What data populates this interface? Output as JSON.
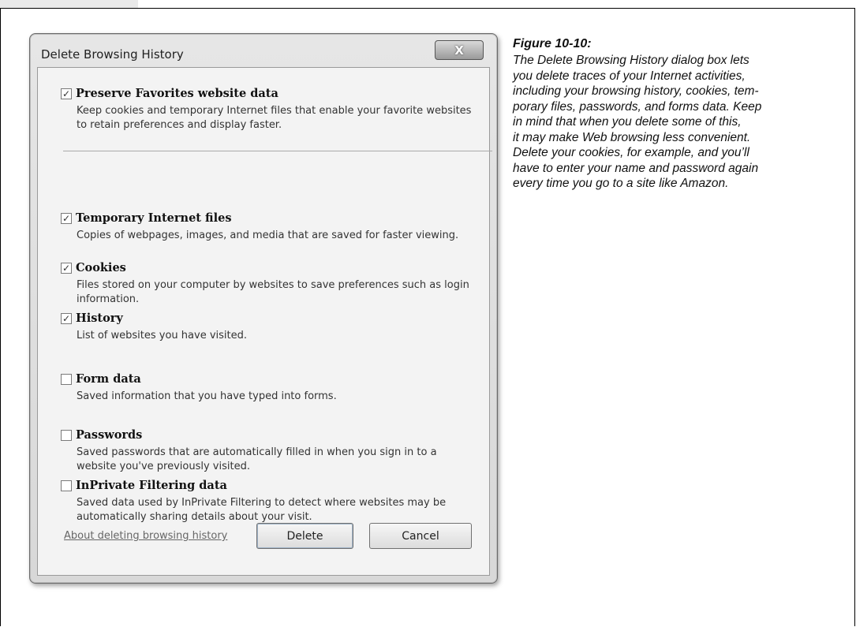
{
  "dialog": {
    "title": "Delete Browsing History",
    "close_label": "X",
    "options": [
      {
        "label": "Preserve Favorites website data",
        "checked": true,
        "description": "Keep cookies and temporary Internet files that enable your favorite websites to retain preferences and display faster."
      },
      {
        "label": "Temporary Internet files",
        "checked": true,
        "description": "Copies of webpages, images, and media that are saved for faster viewing."
      },
      {
        "label": "Cookies",
        "checked": true,
        "description": "Files stored on your computer by websites to save preferences such as login information."
      },
      {
        "label": "History",
        "checked": true,
        "description": "List of websites you have visited."
      },
      {
        "label": "Form data",
        "checked": false,
        "description": "Saved information that you have typed into forms."
      },
      {
        "label": "Passwords",
        "checked": false,
        "description": "Saved passwords that are automatically filled in when you sign in to a website you've previously visited."
      },
      {
        "label": "InPrivate Filtering data",
        "checked": false,
        "description": "Saved data used by InPrivate Filtering to detect where websites may be automatically sharing details about your visit."
      }
    ],
    "about_link": "About deleting browsing history",
    "delete_label": "Delete",
    "cancel_label": "Cancel"
  },
  "caption": {
    "title": "Figure 10-10:",
    "lines": [
      "The Delete Browsing History dialog box lets",
      "you delete traces of your Internet activities,",
      "including your browsing history, cookies, tem-",
      "porary files, passwords, and forms data. Keep",
      "in mind that when you delete some of this,",
      "it may make Web browsing less convenient.",
      "Delete your cookies, for example, and you’ll",
      "have to enter your name and password again",
      "every time you go to a site like Amazon."
    ]
  }
}
